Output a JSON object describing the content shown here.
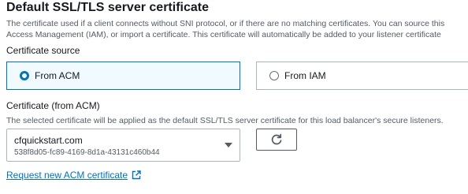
{
  "section": {
    "title": "Default SSL/TLS server certificate",
    "description_line1": "The certificate used if a client connects without SNI protocol, or if there are no matching certificates. You can source this",
    "description_line2": "Access Management (IAM), or import a certificate. This certificate will automatically be added to your listener certificate"
  },
  "certificate_source": {
    "label": "Certificate source",
    "options": [
      {
        "label": "From ACM",
        "selected": true
      },
      {
        "label": "From IAM",
        "selected": false
      }
    ]
  },
  "certificate": {
    "label": "Certificate (from ACM)",
    "description": "The selected certificate will be applied as the default SSL/TLS server certificate for this load balancer's secure listeners.",
    "selected_name": "cfquickstart.com",
    "selected_id": "538f8d05-fc89-4169-8d1a-43131c460b44"
  },
  "request_link": {
    "label": "Request new ACM certificate",
    "icon": "external-link-icon"
  },
  "refresh_button": {
    "icon": "refresh-icon"
  },
  "colors": {
    "accent": "#0073bb",
    "selected_bg": "#f1faff",
    "border": "#aab7b8",
    "text": "#16191f",
    "muted": "#545b64"
  }
}
